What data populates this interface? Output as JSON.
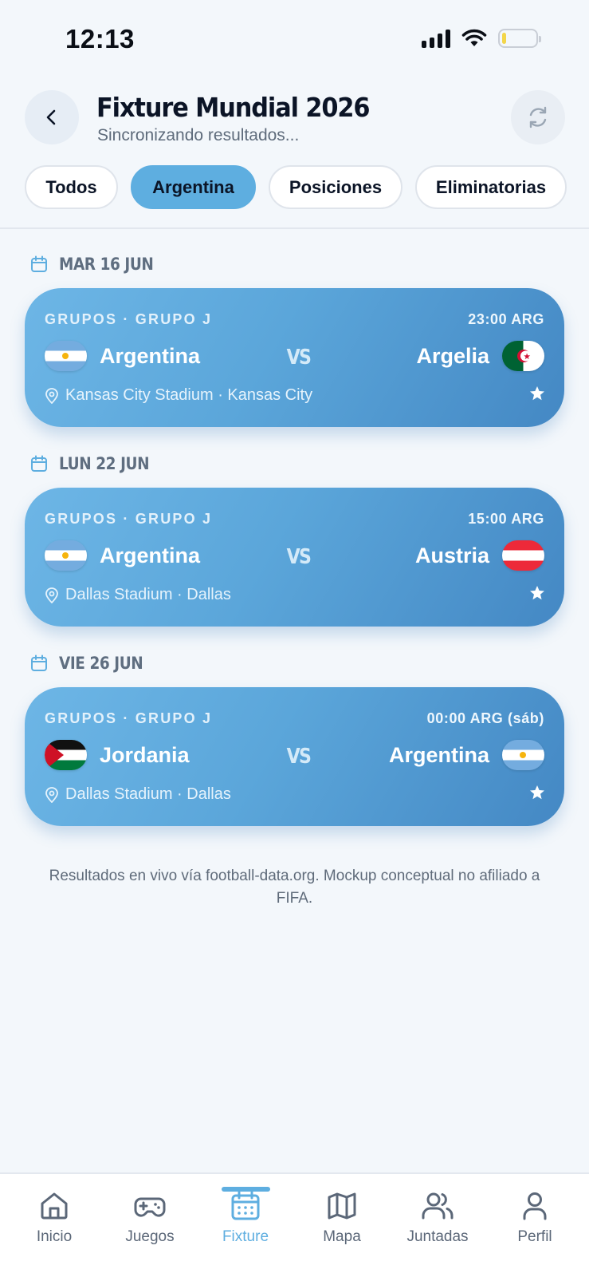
{
  "status_bar": {
    "time": "12:13"
  },
  "header": {
    "title": "Fixture Mundial 2026",
    "subtitle": "Sincronizando resultados..."
  },
  "tabs": [
    {
      "label": "Todos",
      "active": false
    },
    {
      "label": "Argentina",
      "active": true
    },
    {
      "label": "Posiciones",
      "active": false
    },
    {
      "label": "Eliminatorias",
      "active": false
    }
  ],
  "matches": [
    {
      "day": "MAR 16 JUN",
      "stage": "GRUPOS · GRUPO J",
      "time": "23:00 ARG",
      "home": {
        "name": "Argentina",
        "flag": "argentina-flag"
      },
      "away": {
        "name": "Argelia",
        "flag": "algeria-flag"
      },
      "vs": "VS",
      "venue": "Kansas City Stadium · Kansas City"
    },
    {
      "day": "LUN 22 JUN",
      "stage": "GRUPOS · GRUPO J",
      "time": "15:00 ARG",
      "home": {
        "name": "Argentina",
        "flag": "argentina-flag"
      },
      "away": {
        "name": "Austria",
        "flag": "austria-flag"
      },
      "vs": "VS",
      "venue": "Dallas Stadium · Dallas"
    },
    {
      "day": "VIE 26 JUN",
      "stage": "GRUPOS · GRUPO J",
      "time": "00:00 ARG (sáb)",
      "home": {
        "name": "Jordania",
        "flag": "jordan-flag"
      },
      "away": {
        "name": "Argentina",
        "flag": "argentina-flag"
      },
      "vs": "VS",
      "venue": "Dallas Stadium · Dallas"
    }
  ],
  "footer_note": "Resultados en vivo vía football-data.org. Mockup conceptual no afiliado a FIFA.",
  "bottom_nav": [
    {
      "label": "Inicio",
      "icon": "home-icon",
      "active": false
    },
    {
      "label": "Juegos",
      "icon": "gamepad-icon",
      "active": false
    },
    {
      "label": "Fixture",
      "icon": "calendar-icon",
      "active": true
    },
    {
      "label": "Mapa",
      "icon": "map-icon",
      "active": false
    },
    {
      "label": "Juntadas",
      "icon": "users-icon",
      "active": false
    },
    {
      "label": "Perfil",
      "icon": "user-icon",
      "active": false
    }
  ],
  "colors": {
    "accent": "#5eaee0",
    "card_start": "#6db6e6",
    "card_end": "#4488c4",
    "background": "#f3f7fb"
  }
}
